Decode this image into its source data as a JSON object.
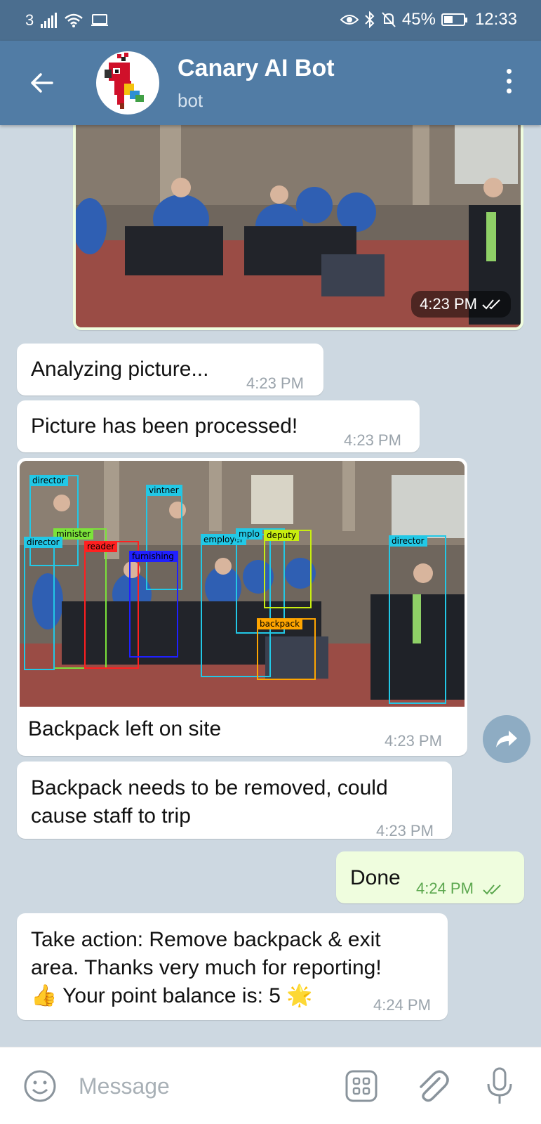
{
  "status_bar": {
    "carrier": "3",
    "battery": "45%",
    "battery_level": 0.45,
    "time": "12:33"
  },
  "header": {
    "title": "Canary AI Bot",
    "subtitle": "bot"
  },
  "messages": {
    "m1_time": "4:23 PM",
    "m2_text": "Analyzing picture...",
    "m2_time": "4:23 PM",
    "m3_text": "Picture has been processed!",
    "m3_time": "4:23 PM",
    "m4_caption": "Backpack left on site",
    "m4_time": "4:23 PM",
    "m5_text": "Backpack needs to be removed, could cause staff to trip",
    "m5_time": "4:23 PM",
    "m6_text": "Done",
    "m6_time": "4:24 PM",
    "m7_line1": "Take action: Remove backpack & exit",
    "m7_line2": "area. Thanks very much for reporting!",
    "m7_line3_emoji1": "👍",
    "m7_line3_text": "Your point balance is: 5",
    "m7_line3_emoji2": "🌟",
    "m7_time": "4:24 PM"
  },
  "detections": [
    {
      "label": "director",
      "color": "#22c8e6"
    },
    {
      "label": "vintner",
      "color": "#22c8e6"
    },
    {
      "label": "minister",
      "color": "#7be33a"
    },
    {
      "label": "director",
      "color": "#22c8e6"
    },
    {
      "label": "reader",
      "color": "#ff2020"
    },
    {
      "label": "furnishing",
      "color": "#2020ff"
    },
    {
      "label": "employer",
      "color": "#22c8e6"
    },
    {
      "label": "mplo",
      "color": "#22c8e6"
    },
    {
      "label": "deputy",
      "color": "#c8ee10"
    },
    {
      "label": "director",
      "color": "#22c8e6"
    },
    {
      "label": "backpack",
      "color": "#ffa500"
    }
  ],
  "input": {
    "placeholder": "Message"
  },
  "colors": {
    "header": "#517ca5",
    "status_bar": "#4b6e8f",
    "chat_bg": "#cdd8e1",
    "outgoing_bubble": "#effdde",
    "read_ticks": "#5ba74e"
  }
}
